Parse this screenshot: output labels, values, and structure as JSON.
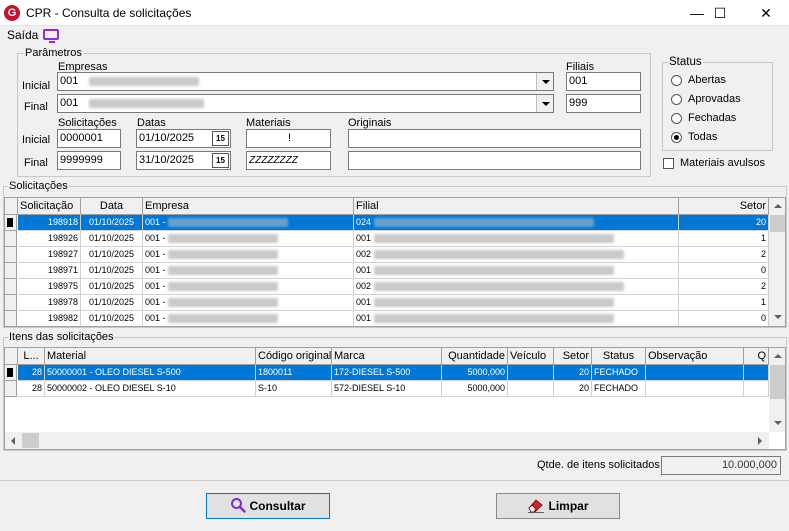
{
  "window": {
    "title": "CPR - Consulta de solicitações",
    "minimize": "—",
    "maximize": "☐",
    "close": "✕"
  },
  "menu": {
    "saida": "Saída"
  },
  "parametros": {
    "legend": "Parâmetros",
    "empresas_label": "Empresas",
    "filiais_label": "Filiais",
    "inicial_label": "Inicial",
    "final_label": "Final",
    "empresa_inicial": "001",
    "empresa_final": "001",
    "filial_inicial": "001",
    "filial_final": "999",
    "solicitacoes_label": "Solicitações",
    "datas_label": "Datas",
    "materiais_label": "Materiais",
    "originais_label": "Originais",
    "solic_inicial": "0000001",
    "solic_final": "9999999",
    "data_inicial": "01/10/2025",
    "data_final": "31/10/2025",
    "material_inicial": "!",
    "material_final": "ZZZZZZZZ",
    "cal_icon": "15"
  },
  "status": {
    "legend": "Status",
    "options": [
      "Abertas",
      "Aprovadas",
      "Fechadas",
      "Todas"
    ],
    "selected": "Todas",
    "avulsos_label": "Materiais avulsos"
  },
  "solicitacoes": {
    "legend": "Solicitações",
    "columns": [
      "Solicitação",
      "Data",
      "Empresa",
      "Filial",
      "Setor"
    ],
    "rows": [
      {
        "solicitacao": "198918",
        "data": "01/10/2025",
        "empresa": "001 -",
        "filial": "024",
        "setor": "20"
      },
      {
        "solicitacao": "198926",
        "data": "01/10/2025",
        "empresa": "001 -",
        "filial": "001",
        "setor": "1"
      },
      {
        "solicitacao": "198927",
        "data": "01/10/2025",
        "empresa": "001 -",
        "filial": "002",
        "setor": "2"
      },
      {
        "solicitacao": "198971",
        "data": "01/10/2025",
        "empresa": "001 -",
        "filial": "001",
        "setor": "0"
      },
      {
        "solicitacao": "198975",
        "data": "01/10/2025",
        "empresa": "001 -",
        "filial": "002",
        "setor": "2"
      },
      {
        "solicitacao": "198978",
        "data": "01/10/2025",
        "empresa": "001 -",
        "filial": "001",
        "setor": "1"
      },
      {
        "solicitacao": "198982",
        "data": "01/10/2025",
        "empresa": "001 -",
        "filial": "001",
        "setor": "0"
      }
    ]
  },
  "itens": {
    "legend": "Itens das solicitações",
    "columns": [
      "L...",
      "Material",
      "Código original",
      "Marca",
      "Quantidade",
      "Veículo",
      "Setor",
      "Status",
      "Observação",
      "Q"
    ],
    "rows": [
      {
        "l": "28",
        "material": "50000001 - OLEO DIESEL S-500",
        "codigo": "1800011",
        "marca": "172-DIESEL S-500",
        "quantidade": "5000,000",
        "veiculo": "",
        "setor": "20",
        "status": "FECHADO",
        "obs": ""
      },
      {
        "l": "28",
        "material": "50000002 - OLEO DIESEL S-10",
        "codigo": "S-10",
        "marca": "572-DIESEL S-10",
        "quantidade": "5000,000",
        "veiculo": "",
        "setor": "20",
        "status": "FECHADO",
        "obs": ""
      }
    ],
    "qtde_label": "Qtde. de itens solicitados",
    "qtde_value": "10.000,000"
  },
  "buttons": {
    "consultar": "Consultar",
    "limpar": "Limpar"
  },
  "colors": {
    "selection": "#0078d7",
    "accent_icon": "#8a2be2"
  }
}
